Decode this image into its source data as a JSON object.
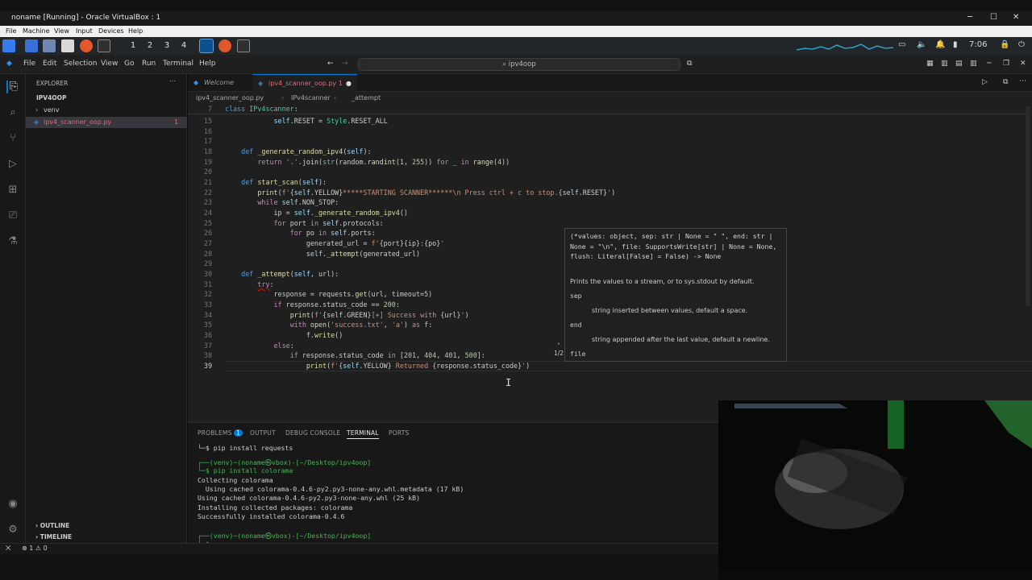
{
  "host": {
    "window_title": "noname [Running] - Oracle VirtualBox : 1",
    "menu": [
      "File",
      "Machine",
      "View",
      "Input",
      "Devices",
      "Help"
    ]
  },
  "guest": {
    "workspaces": [
      "1",
      "2",
      "3",
      "4"
    ],
    "clock": "7:06"
  },
  "vscode": {
    "menu": [
      "File",
      "Edit",
      "Selection",
      "View",
      "Go",
      "Run",
      "Terminal",
      "Help"
    ],
    "search": "ipv4oop",
    "explorer_title": "EXPLORER",
    "folder": "IPV4OOP",
    "items": [
      {
        "label": "venv"
      },
      {
        "label": "ipv4_scanner_oop.py",
        "badge": "1"
      }
    ],
    "outline": "OUTLINE",
    "timeline": "TIMELINE",
    "tabs": [
      {
        "label": "Welcome"
      },
      {
        "label": "ipv4_scanner_oop.py 1"
      }
    ],
    "breadcrumb": [
      "ipv4_scanner_oop.py",
      "IPv4scanner",
      "_attempt"
    ],
    "sticky": {
      "num": "7",
      "text": "class IPv4scanner:"
    },
    "hover": {
      "signature": "(*values: object, sep: str | None = \" \", end: str | None = \"\\n\", file: SupportsWrite[str] | None = None, flush: Literal[False] = False) -> None",
      "summary": "Prints the values to a stream, or to sys.stdout by default.",
      "sep_label": "sep",
      "sep_desc": "string inserted between values, default a space.",
      "end_label": "end",
      "end_desc": "string appended after the last value, default a newline.",
      "file_label": "file",
      "overload": "1/2"
    },
    "panel_tabs": [
      "PROBLEMS",
      "OUTPUT",
      "DEBUG CONSOLE",
      "TERMINAL",
      "PORTS"
    ],
    "problems_count": "1",
    "terminal": [
      "└─$ pip install requests",
      "┌──(venv)─(noname㉿vbox)-[~/Desktop/ipv4oop]",
      "└─$ pip install colorama",
      "Collecting colorama",
      "  Using cached colorama-0.4.6-py2.py3-none-any.whl.metadata (17 kB)",
      "Using cached colorama-0.4.6-py2.py3-none-any.whl (25 kB)",
      "Installing collected packages: colorama",
      "Successfully installed colorama-0.4.6",
      "",
      "┌──(venv)─(noname㉿vbox)-[~/Desktop/ipv4oop]",
      "└─$ "
    ],
    "status": {
      "errors": "1",
      "warnings": "0"
    }
  }
}
